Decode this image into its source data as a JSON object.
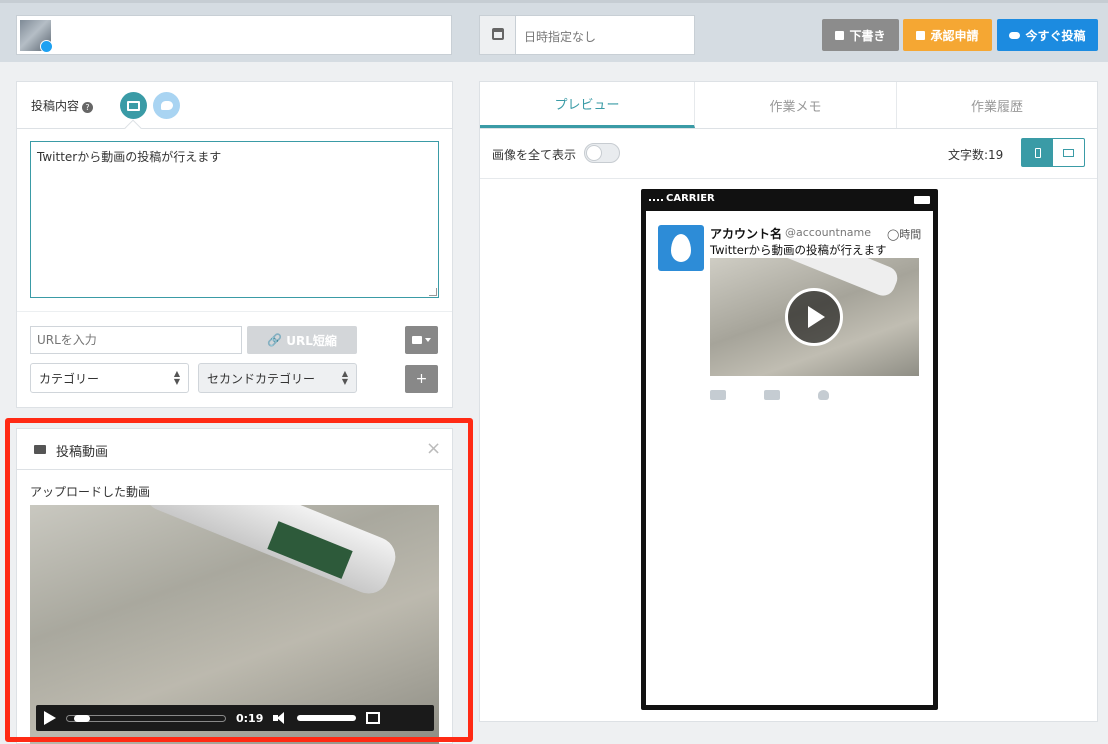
{
  "header": {
    "schedule_placeholder": "日時指定なし",
    "buttons": {
      "draft": "下書き",
      "approve": "承認申請",
      "post_now": "今すぐ投稿"
    },
    "colors": {
      "draft": "#8c8c8c",
      "approve": "#f5a733",
      "post_now": "#1c8be0"
    }
  },
  "composer": {
    "tab_label": "投稿内容",
    "help_icon": "?",
    "tab_icons": [
      "monitor-icon",
      "twitter-icon"
    ],
    "text": "Twitterから動画の投稿が行えます",
    "url_placeholder": "URLを入力",
    "url_shorten_label": "URL短縮",
    "category_select": "カテゴリー",
    "second_category_select": "セカンドカテゴリー",
    "add_label": "+"
  },
  "video_panel": {
    "title": "投稿動画",
    "close": "×",
    "upload_label": "アップロードした動画",
    "player": {
      "time": "0:19",
      "progress_fraction": 0.05,
      "volume_fraction": 0.95
    }
  },
  "preview": {
    "tabs": [
      "プレビュー",
      "作業メモ",
      "作業履歴"
    ],
    "active_tab": 0,
    "show_all_images_label": "画像を全て表示",
    "char_count_label": "文字数:19",
    "phone": {
      "carrier": "CARRIER",
      "account_name": "アカウント名",
      "handle": "@accountname",
      "time": "◯時間",
      "tweet_text": "Twitterから動画の投稿が行えます"
    },
    "accent_color": "#3a9ba6"
  }
}
